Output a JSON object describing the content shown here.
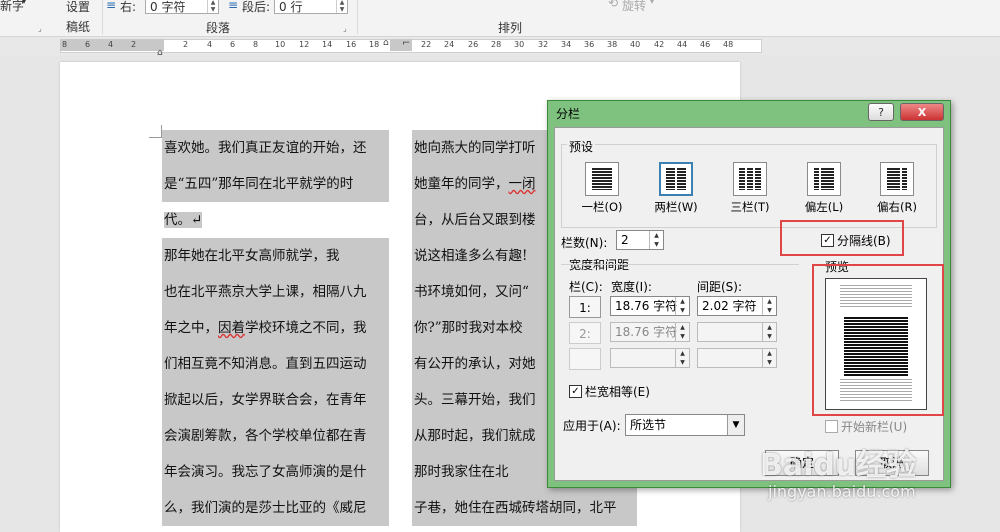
{
  "ribbon": {
    "left_label": "新字",
    "setup": "设置",
    "paper": "稿纸",
    "right_indent_label": "右:",
    "right_indent_value": "0 字符",
    "after_label": "段后:",
    "after_value": "0 行",
    "paragraph_group": "段落",
    "arrange_group": "排列",
    "rotate": "旋转"
  },
  "ruler": {
    "ticks": [
      "8",
      "6",
      "4",
      "2",
      "2",
      "4",
      "6",
      "8",
      "10",
      "12",
      "14",
      "16",
      "18",
      "22",
      "24",
      "26",
      "28",
      "30",
      "32",
      "34",
      "36",
      "38",
      "40",
      "42",
      "44",
      "46",
      "48"
    ]
  },
  "document": {
    "left_column": [
      "喜欢她。我们真正友谊的开始，还",
      "是“五四”那年同在北平就学的时",
      "代。↵",
      "    那年她在北平女高师就学，我",
      "也在北平燕京大学上课，相隔八九",
      "年之中，因着学校环境之不同，我",
      "们相互竟不知消息。直到五四运动",
      "掀起以后，女学界联合会，在青年",
      "会演剧筹款，各个学校单位都在青",
      "年会演习。我忘了女高师演的是什",
      "么，我们演的是莎士比亚的《威尼"
    ],
    "left_wavy": "因着",
    "right_column": [
      "她向燕大的同学打听",
      "她童年的同学，一闭",
      "台，从后台又跟到楼",
      "说这相逢多么有趣!",
      "书环境如何，又问“",
      "你?”那时我对本校",
      "有公开的承认，对她",
      "头。三幕开始，我们",
      "从那时起，我们就成",
      "    那时我家住在北",
      "子巷，她住在西城砖塔胡同，北平"
    ],
    "right_wavy": "一闭"
  },
  "dialog": {
    "title": "分栏",
    "help": "?",
    "close": "X",
    "presets_label": "预设",
    "presets": [
      {
        "label": "一栏(O)",
        "cols": 1
      },
      {
        "label": "两栏(W)",
        "cols": 2
      },
      {
        "label": "三栏(T)",
        "cols": 3
      },
      {
        "label": "偏左(L)",
        "cols": 2
      },
      {
        "label": "偏右(R)",
        "cols": 2
      }
    ],
    "num_columns_label": "栏数(N):",
    "num_columns_value": "2",
    "line_between_label": "分隔线(B)",
    "line_between_checked": true,
    "width_spacing_label": "宽度和间距",
    "preview_label": "预览",
    "col_header": "栏(C):",
    "width_header": "宽度(I):",
    "spacing_header": "间距(S):",
    "rows": [
      {
        "num": "1:",
        "width": "18.76 字符",
        "spacing": "2.02 字符"
      },
      {
        "num": "2:",
        "width": "18.76 字符",
        "spacing": ""
      },
      {
        "num": "",
        "width": "",
        "spacing": ""
      }
    ],
    "equal_width_label": "栏宽相等(E)",
    "equal_width_checked": true,
    "apply_to_label": "应用于(A):",
    "apply_to_value": "所选节",
    "new_column_label": "开始新栏(U)",
    "ok": "确定",
    "cancel": "取消"
  },
  "watermark": {
    "logo": "Baidu经验",
    "url": "jingyan.baidu.com"
  }
}
